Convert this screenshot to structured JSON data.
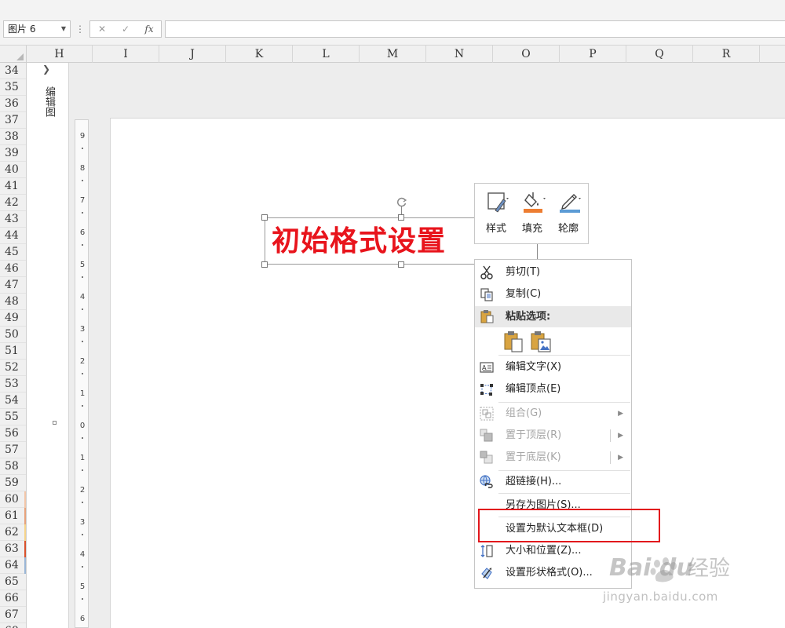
{
  "formula_bar": {
    "name_box": "图片 6",
    "more_icon": "⋮",
    "cancel_icon": "✕",
    "enter_icon": "✓",
    "function_icon": "fx",
    "value": ""
  },
  "columns": [
    "H",
    "I",
    "J",
    "K",
    "L",
    "M",
    "N",
    "O",
    "P",
    "Q",
    "R"
  ],
  "rows": [
    "34",
    "35",
    "36",
    "37",
    "38",
    "39",
    "40",
    "41",
    "42",
    "43",
    "44",
    "45",
    "46",
    "47",
    "48",
    "49",
    "50",
    "51",
    "52",
    "53",
    "54",
    "55",
    "56",
    "57",
    "58",
    "59",
    "60",
    "61",
    "62",
    "63",
    "64",
    "65",
    "66",
    "67",
    "68"
  ],
  "edit_pane": {
    "label": "编辑图"
  },
  "ruler": {
    "labels": [
      "9",
      "8",
      "7",
      "6",
      "5",
      "4",
      "3",
      "2",
      "1",
      "0",
      "1",
      "2",
      "3",
      "4",
      "5",
      "6"
    ]
  },
  "text_box": {
    "text": "初始格式设置",
    "color": "#e8141c"
  },
  "mini_toolbar": {
    "style_label": "样式",
    "fill_label": "填充",
    "outline_label": "轮廓",
    "fill_color": "#ed7d31",
    "outline_color": "#5b9bd5"
  },
  "context_menu": {
    "cut": "剪切(T)",
    "copy": "复制(C)",
    "paste_options": "粘贴选项:",
    "edit_text": "编辑文字(X)",
    "edit_points": "编辑顶点(E)",
    "group": "组合(G)",
    "bring_to_front": "置于顶层(R)",
    "send_to_back": "置于底层(K)",
    "hyperlink": "超链接(H)...",
    "save_as_picture": "另存为图片(S)...",
    "set_default_textbox": "设置为默认文本框(D)",
    "size_position": "大小和位置(Z)...",
    "format_shape": "设置形状格式(O)..."
  },
  "highlight_color": "#e2161c",
  "watermark": {
    "brand": "Bai du",
    "cn": "经验",
    "url": "jingyan.baidu.com"
  }
}
